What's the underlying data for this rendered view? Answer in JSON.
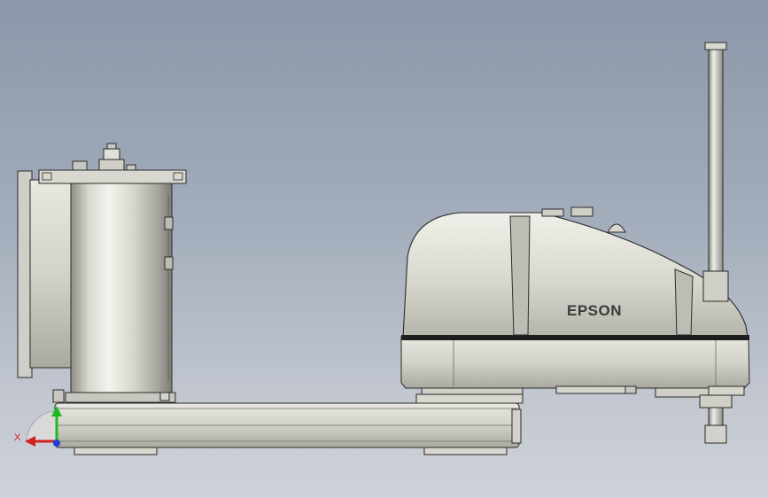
{
  "scene": {
    "brand_text": "EPSON",
    "triad_x_label": "X",
    "colors": {
      "background_top": "#8b97a9",
      "background_bottom": "#cfd2d8",
      "metal_light": "#e4e4dc",
      "metal_mid": "#c9c9c0",
      "metal_dark": "#9a9a92",
      "outline": "#2a2a2a",
      "base_stripe": "#1e1e1e",
      "axis_x": "#d12020",
      "axis_y": "#1fb81f",
      "axis_z": "#1f3fd1"
    }
  }
}
